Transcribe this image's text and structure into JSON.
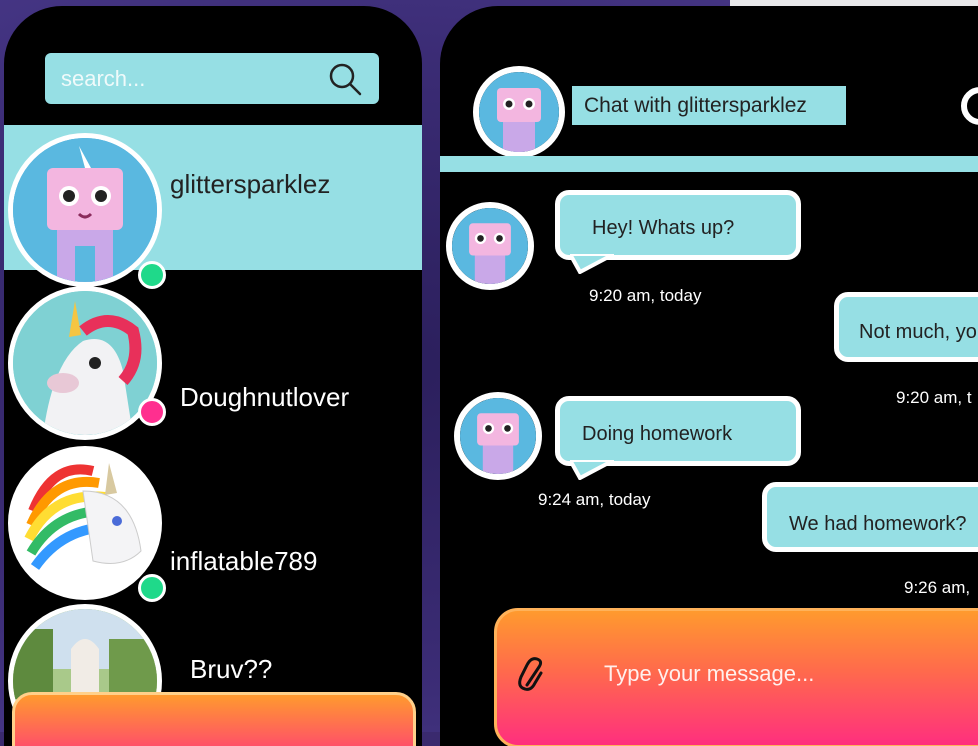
{
  "browser": {
    "url": "https://drive.google.com/drive/u/0"
  },
  "sidebar": {
    "search_placeholder": "search...",
    "contacts": [
      {
        "name": "glittersparklez",
        "status_color": "#1fd98a",
        "active": true,
        "avatar": "unikitty-avatar"
      },
      {
        "name": "Doughnutlover",
        "status_color": "#ff2f8f",
        "active": false,
        "avatar": "unicorn-float-avatar"
      },
      {
        "name": "inflatable789",
        "status_color": "#1fd98a",
        "active": false,
        "avatar": "rainbow-unicorn-avatar"
      },
      {
        "name": "Bruv??",
        "status_color": null,
        "active": false,
        "avatar": "outdoor-unicorn-avatar"
      }
    ]
  },
  "chat": {
    "title": "Chat with glittersparklez",
    "messages": [
      {
        "from": "them",
        "text": "Hey! Whats up?",
        "time": "9:20 am, today"
      },
      {
        "from": "me",
        "text": "Not much, yo",
        "time": "9:20 am, t"
      },
      {
        "from": "them",
        "text": "Doing homework",
        "time": "9:24 am, today"
      },
      {
        "from": "me",
        "text": "We had homework?",
        "time": "9:26 am,"
      }
    ],
    "composer_placeholder": "Type your message..."
  },
  "colors": {
    "accent": "#96dfe4",
    "online": "#1fd98a",
    "away": "#ff2f8f",
    "composer_start": "#ff9a2e",
    "composer_end": "#ff2f7e"
  }
}
